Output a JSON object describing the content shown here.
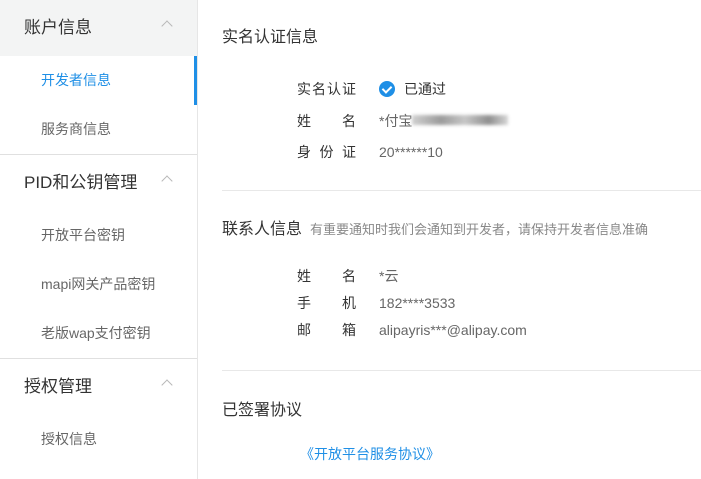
{
  "sidebar": {
    "groups": [
      {
        "title": "账户信息",
        "items": [
          {
            "label": "开发者信息"
          },
          {
            "label": "服务商信息"
          }
        ]
      },
      {
        "title": "PID和公钥管理",
        "items": [
          {
            "label": "开放平台密钥"
          },
          {
            "label": "mapi网关产品密钥"
          },
          {
            "label": "老版wap支付密钥"
          }
        ]
      },
      {
        "title": "授权管理",
        "items": [
          {
            "label": "授权信息"
          }
        ]
      }
    ],
    "active_item": "开发者信息"
  },
  "realname": {
    "title": "实名认证信息",
    "status_label": "实名认证",
    "status_value": "已通过",
    "name_label": "姓　　名",
    "name_value": "*付宝",
    "id_label": "身 份 证",
    "id_value": "20******10"
  },
  "contact": {
    "title": "联系人信息",
    "subtitle": "有重要通知时我们会通知到开发者，请保持开发者信息准确",
    "name_label": "姓　　名",
    "name_value": "*云",
    "phone_label": "手　　机",
    "phone_value": "182****3533",
    "email_label": "邮　　箱",
    "email_value": "alipayris***@alipay.com"
  },
  "agreements": {
    "title": "已签署协议",
    "items": [
      "《开放平台服务协议》"
    ]
  },
  "colors": {
    "accent": "#1f8fe6",
    "active_group_bg": "#f3f4f4"
  }
}
